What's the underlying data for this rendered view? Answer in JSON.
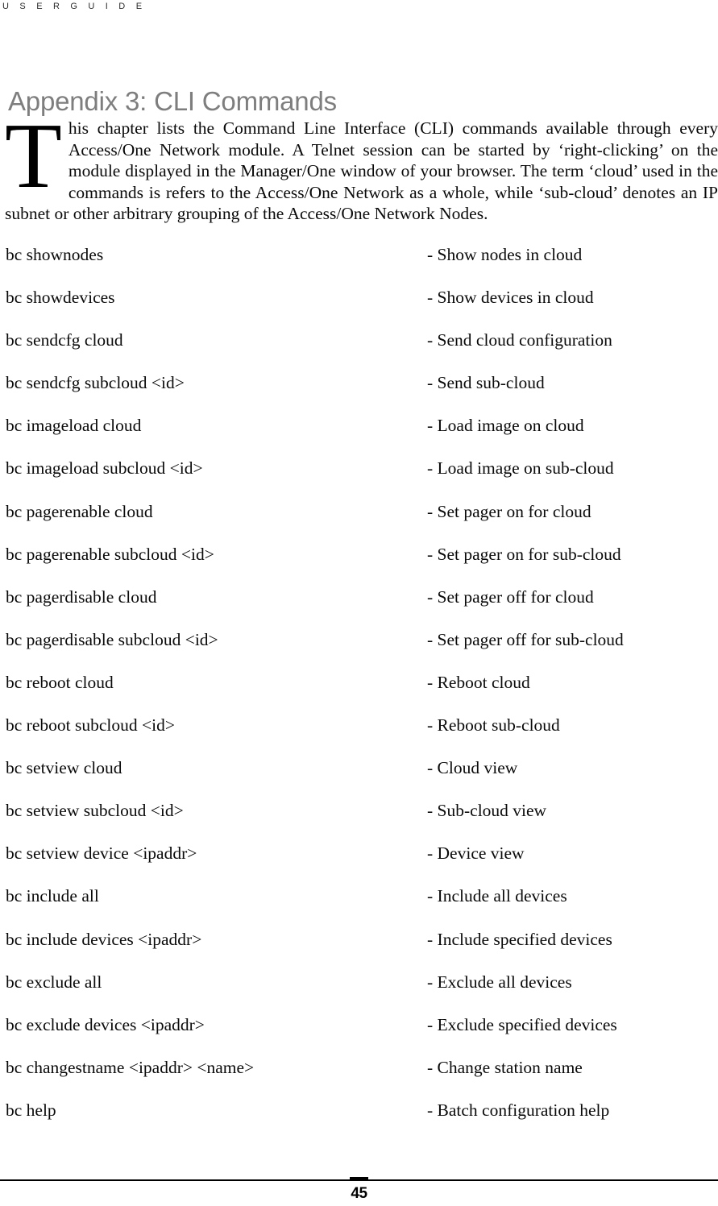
{
  "header": {
    "running_head": "U S E R   G U I D E"
  },
  "title": {
    "text": "Appendix 3: CLI Commands"
  },
  "intro": {
    "dropcap": "T",
    "body": "his chapter lists the Command Line Interface (CLI) commands available through every Access/One Network module. A Telnet session can be started by ‘right-clicking’ on the module displayed in the Manager/One window of your browser. The term ‘cloud’ used in the commands is refers to the Access/One Network as a whole, while ‘sub-cloud’ denotes an IP subnet or other arbitrary grouping of the Access/One Network Nodes."
  },
  "commands": [
    {
      "name": "bc shownodes",
      "desc": "- Show nodes in cloud"
    },
    {
      "name": "bc showdevices",
      "desc": "- Show devices in cloud"
    },
    {
      "name": "bc sendcfg cloud",
      "desc": "- Send cloud configuration"
    },
    {
      "name": "bc sendcfg subcloud <id>",
      "desc": "- Send sub-cloud"
    },
    {
      "name": "bc imageload cloud",
      "desc": "- Load image on cloud"
    },
    {
      "name": "bc imageload subcloud <id>",
      "desc": "- Load image on sub-cloud"
    },
    {
      "name": "bc pagerenable cloud",
      "desc": "- Set pager on for cloud"
    },
    {
      "name": "bc pagerenable subcloud <id>",
      "desc": "- Set pager on for sub-cloud"
    },
    {
      "name": "bc pagerdisable cloud",
      "desc": "- Set pager off for cloud"
    },
    {
      "name": "bc pagerdisable subcloud <id>",
      "desc": "- Set pager off for sub-cloud"
    },
    {
      "name": "bc reboot cloud",
      "desc": "- Reboot cloud"
    },
    {
      "name": "bc reboot subcloud <id>",
      "desc": "- Reboot sub-cloud"
    },
    {
      "name": "bc setview cloud",
      "desc": "- Cloud view"
    },
    {
      "name": "bc setview subcloud <id>",
      "desc": "- Sub-cloud view"
    },
    {
      "name": "bc setview device <ipaddr>",
      "desc": "- Device view"
    },
    {
      "name": "bc include all",
      "desc": "- Include all devices"
    },
    {
      "name": "bc include devices <ipaddr>",
      "desc": "- Include specified devices"
    },
    {
      "name": "bc exclude all",
      "desc": "- Exclude all devices"
    },
    {
      "name": "bc exclude devices <ipaddr>",
      "desc": "- Exclude specified devices"
    },
    {
      "name": "bc changestname <ipaddr> <name>",
      "desc": "- Change station name"
    },
    {
      "name": "bc help",
      "desc": "- Batch configuration help"
    }
  ],
  "footer": {
    "page_number": "45"
  },
  "colors": {
    "title_gray": "#7e7e7e",
    "body_black": "#0a0a0a",
    "rule_black": "#000000",
    "page_background": "#ffffff"
  }
}
